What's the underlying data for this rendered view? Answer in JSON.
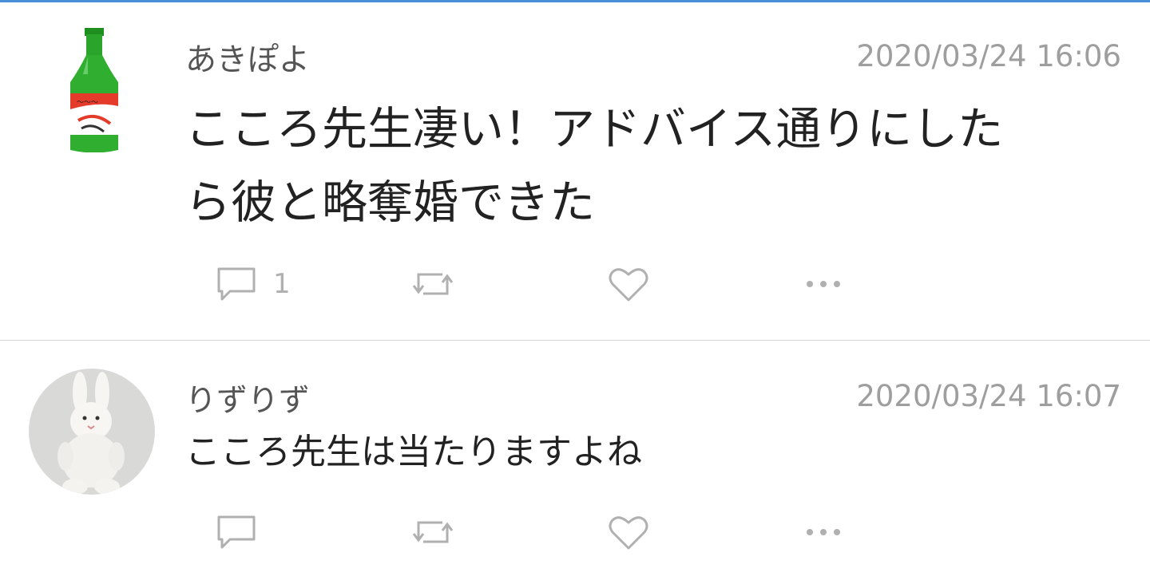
{
  "posts": [
    {
      "author": "あきぽよ",
      "timestamp": "2020/03/24 16:06",
      "body_lines": [
        "こころ先生凄い！アドバイス通りにした",
        "ら彼と略奪婚できた"
      ],
      "reply_count": "1",
      "avatar": "sake-bottle-avatar"
    },
    {
      "author": "りずりず",
      "timestamp": "2020/03/24 16:07",
      "body_lines": [
        "こころ先生は当たりますよね"
      ],
      "reply_count": "",
      "avatar": "white-rabbit-plush-avatar"
    }
  ],
  "icons": {
    "reply": "comment-icon",
    "retweet": "retweet-icon",
    "like": "heart-icon",
    "more": "more-dots-icon"
  },
  "colors": {
    "accent_line": "#4a90d9",
    "author_text": "#555555",
    "timestamp_text": "#9e9e9e",
    "body_text": "#222222",
    "icon_gray": "#b0b0b0",
    "divider": "#d6d6d6"
  }
}
